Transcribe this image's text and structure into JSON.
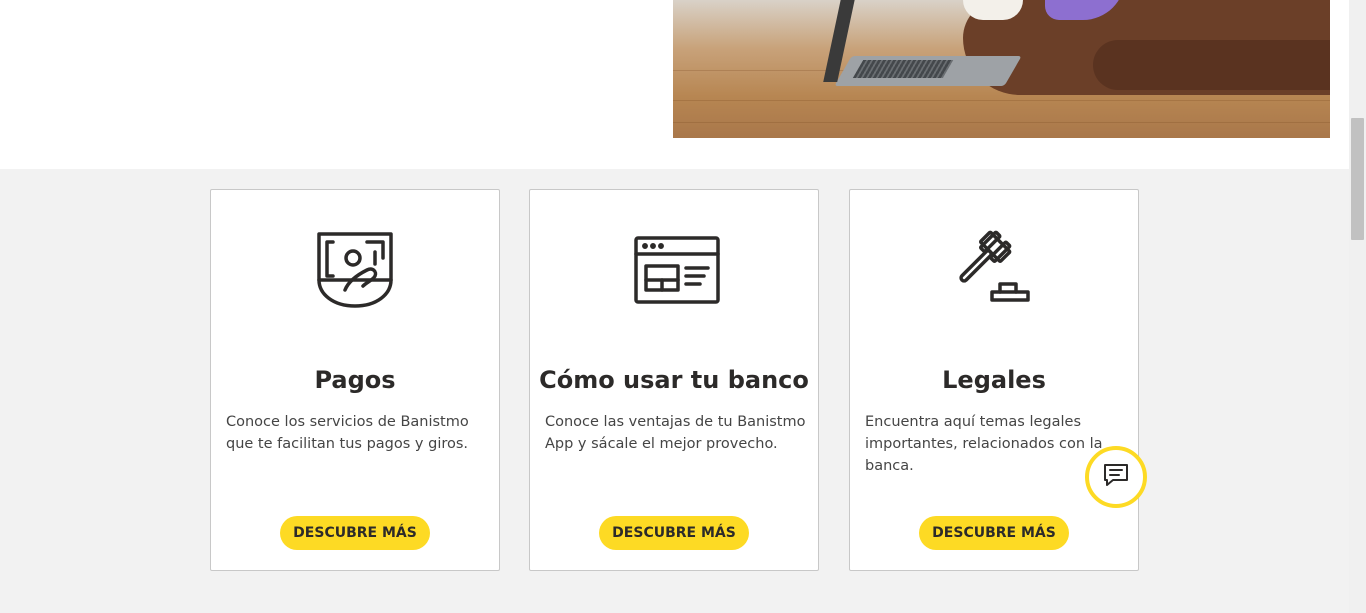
{
  "cards": [
    {
      "icon": "payments-hand-icon",
      "title": "Pagos",
      "description": "Conoce los servicios de Banistmo que te facilitan tus pagos y giros.",
      "button_label": "DESCUBRE MÁS"
    },
    {
      "icon": "browser-window-icon",
      "title": "Cómo usar tu banco",
      "description": "Conoce las ventajas de tu Banistmo App y sácale el mejor provecho.",
      "button_label": "DESCUBRE MÁS"
    },
    {
      "icon": "gavel-icon",
      "title": "Legales",
      "description": "Encuentra aquí temas legales importantes, relacionados con la banca.",
      "button_label": "DESCUBRE MÁS"
    }
  ],
  "chat": {
    "icon": "chat-bubble-icon"
  },
  "colors": {
    "accent": "#fdda24",
    "text": "#2c2a29",
    "section_background": "#f2f2f2",
    "card_border": "#c8c8c8"
  }
}
